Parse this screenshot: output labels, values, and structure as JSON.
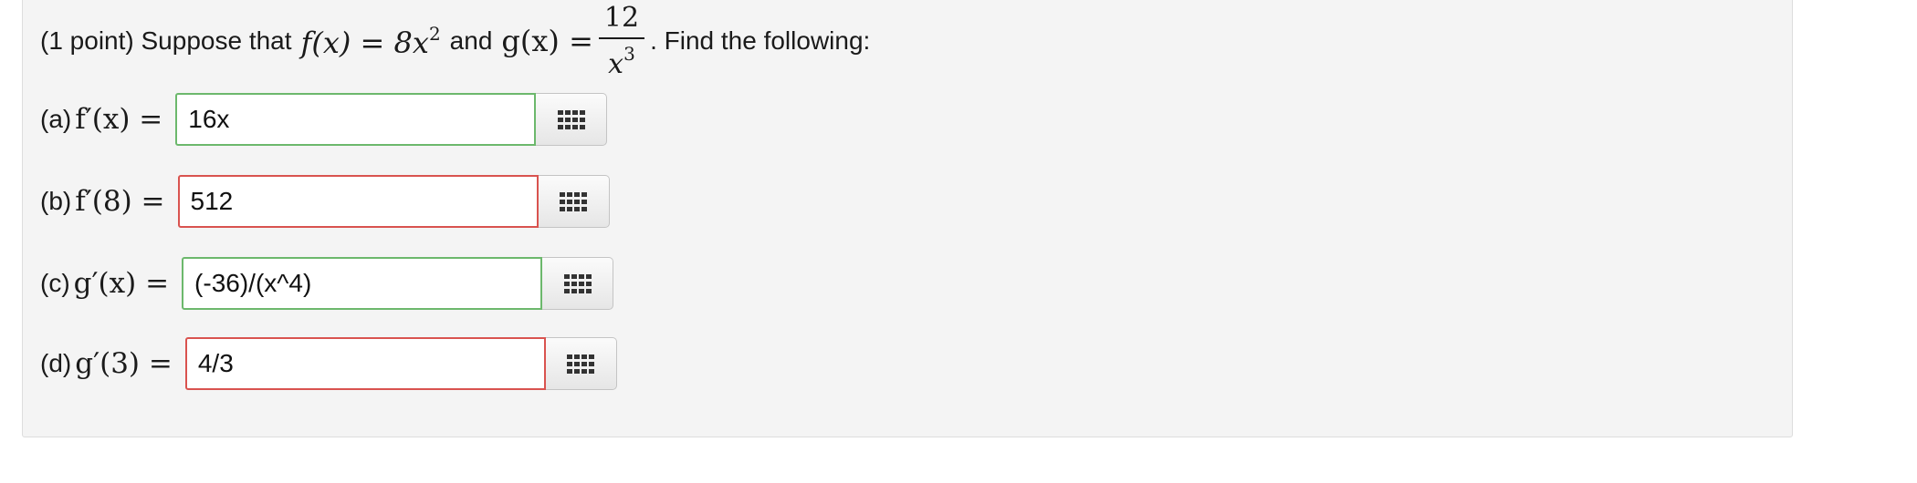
{
  "problem": {
    "point_label": "(1 point) Suppose that",
    "f_def": "f(x) = 8x",
    "f_exp": "2",
    "and_text": "and",
    "g_lhs": "g(x) =",
    "g_num": "12",
    "g_den": "x",
    "g_den_exp": "3",
    "tail_text": ". Find the following:"
  },
  "parts": [
    {
      "prefix": "(a)",
      "expr": "f′(x) =",
      "value": "16x",
      "status": "correct"
    },
    {
      "prefix": "(b)",
      "expr": "f′(8) =",
      "value": "512",
      "status": "incorrect"
    },
    {
      "prefix": "(c)",
      "expr": "g′(x) =",
      "value": "(-36)/(x^4)",
      "status": "correct"
    },
    {
      "prefix": "(d)",
      "expr": "g′(3) =",
      "value": "4/3",
      "status": "incorrect"
    }
  ],
  "colors": {
    "correct_border": "#6cb86c",
    "incorrect_border": "#d9534f",
    "panel_background": "#f4f4f4"
  },
  "icons": {
    "palette_button": "grid-icon"
  }
}
